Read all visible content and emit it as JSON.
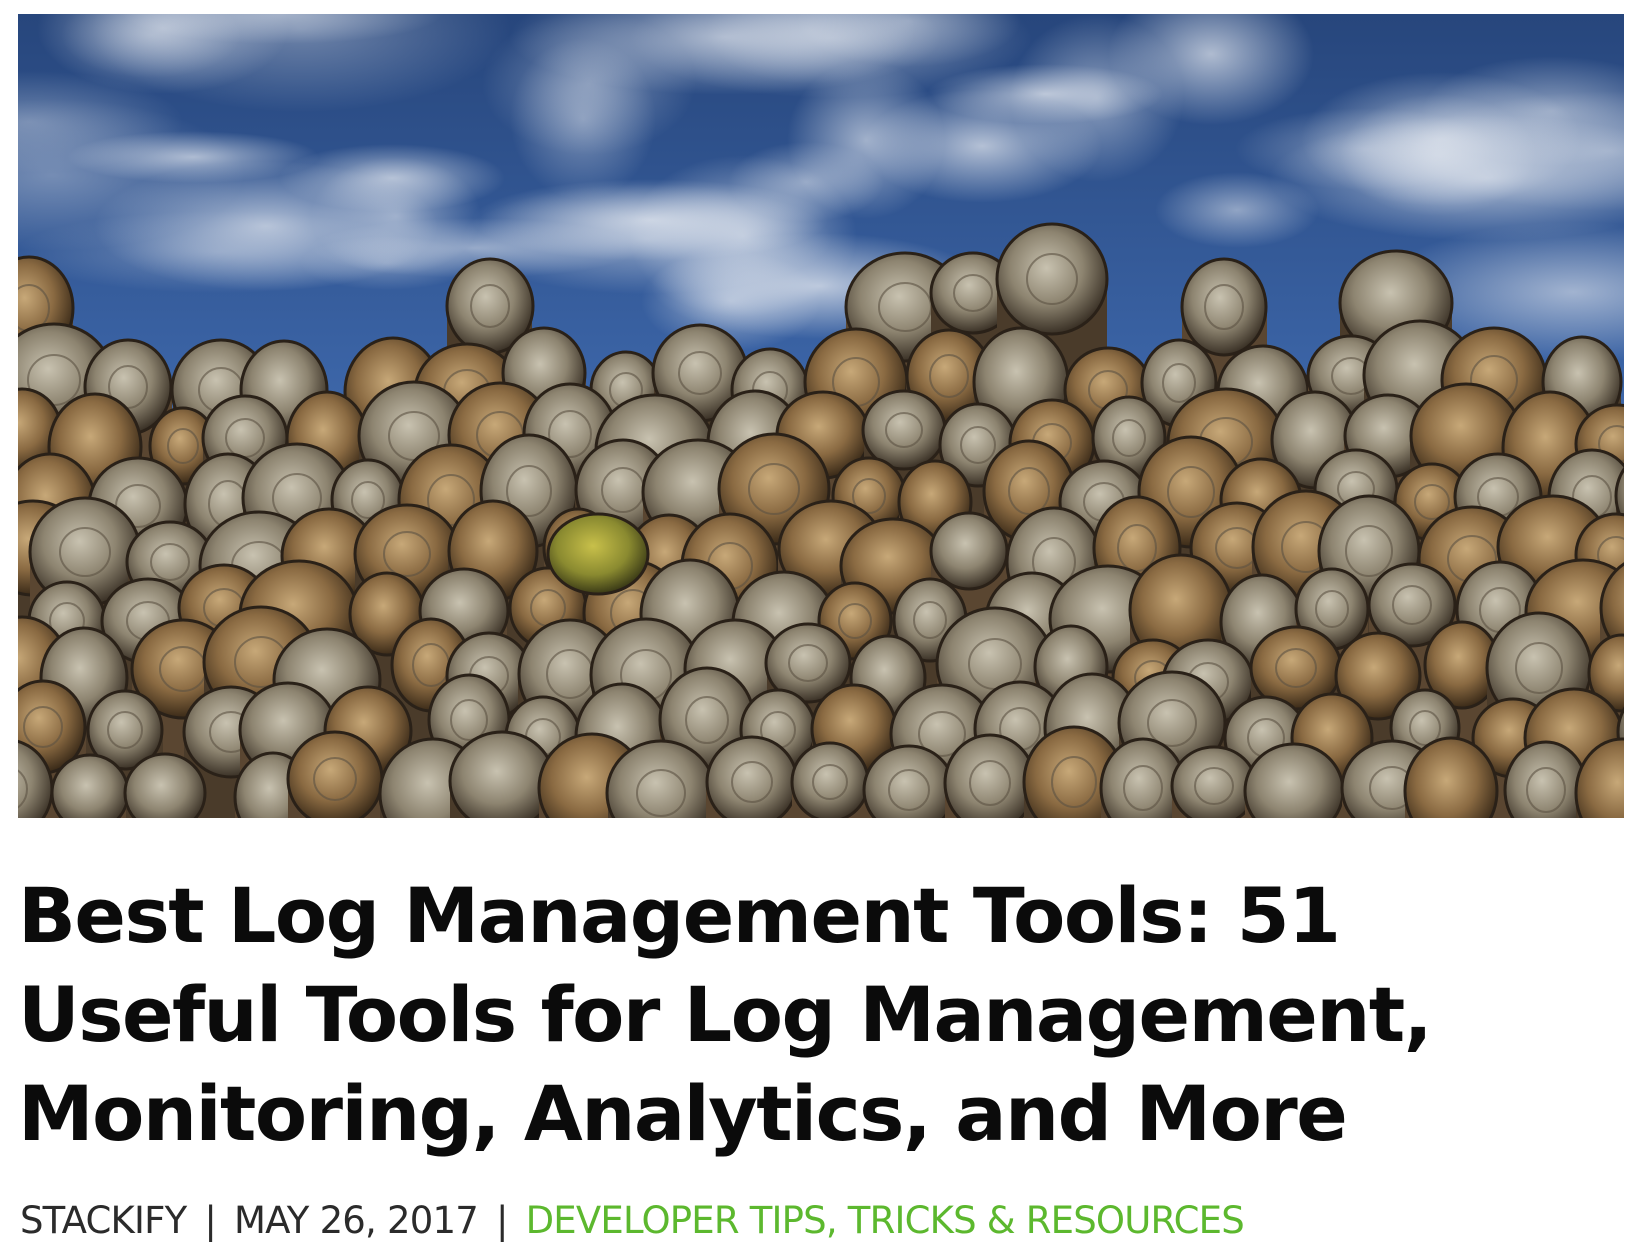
{
  "hero": {
    "icon": "log-pile-photo"
  },
  "article": {
    "title_lines": [
      "Best Log Management Tools: 51",
      "Useful Tools for Log Management,",
      "Monitoring, Analytics, and More"
    ],
    "author": "STACKIFY",
    "date": "MAY 26, 2017",
    "separator": "|",
    "category": "DEVELOPER TIPS, TRICKS & RESOURCES"
  },
  "colors": {
    "title": "#0b0b0b",
    "meta_text": "#2b2b2b",
    "category_link": "#5cb82e",
    "sky": "#2f4f86"
  }
}
